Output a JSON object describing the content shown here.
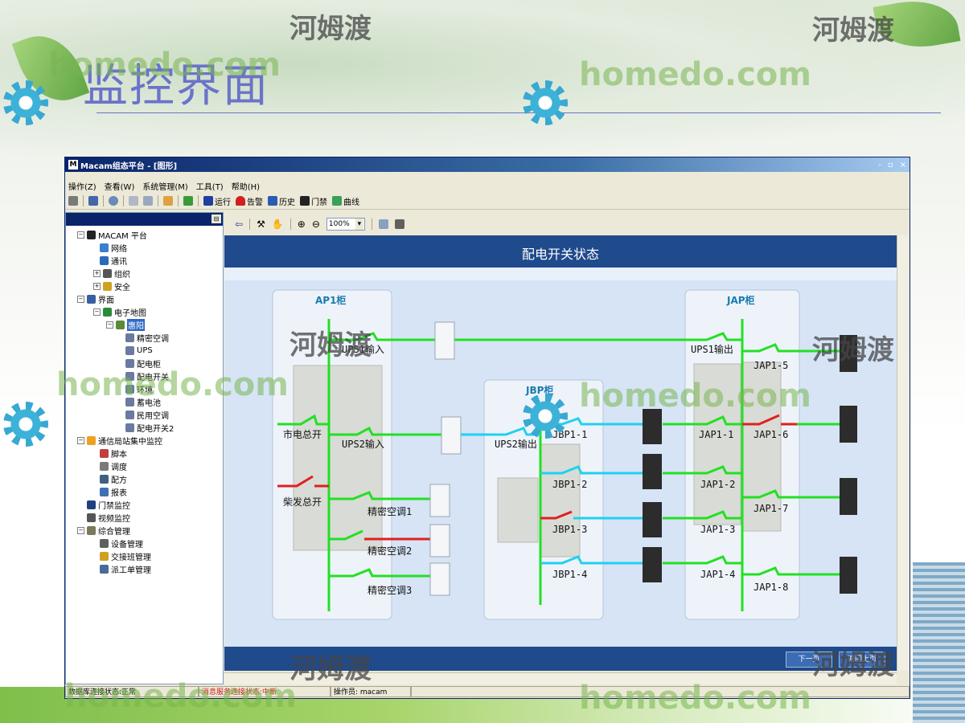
{
  "slide": {
    "title": "监控界面",
    "watermark_text_en": "homedo.com",
    "watermark_text_cn": "河姆渡"
  },
  "window": {
    "title": "Macam组态平台 - [图形]",
    "controls": [
      "-",
      "▫",
      "×"
    ]
  },
  "menu": [
    "操作(Z)",
    "查看(W)",
    "系统管理(M)",
    "工具(T)",
    "帮助(H)"
  ],
  "toolbar": {
    "buttons": [
      "运行",
      "告警",
      "历史",
      "门禁",
      "曲线"
    ]
  },
  "graphics_toolbar": {
    "zoom": "100%"
  },
  "tree": {
    "items": [
      {
        "label": "MACAM 平台",
        "icon": "macam-icon"
      },
      {
        "label": "网络",
        "icon": "network-icon"
      },
      {
        "label": "通讯",
        "icon": "globe-icon"
      },
      {
        "label": "组织",
        "icon": "org-icon"
      },
      {
        "label": "安全",
        "icon": "lock-icon"
      },
      {
        "label": "界面",
        "icon": "monitor-icon"
      },
      {
        "label": "电子地图",
        "icon": "globe-icon"
      },
      {
        "label": "惠阳",
        "icon": "node-icon"
      },
      {
        "label": "精密空调",
        "icon": "device-icon"
      },
      {
        "label": "UPS",
        "icon": "device-icon"
      },
      {
        "label": "配电柜",
        "icon": "device-icon"
      },
      {
        "label": "配电开关",
        "icon": "device-icon"
      },
      {
        "label": "环境",
        "icon": "device-icon"
      },
      {
        "label": "蓄电池",
        "icon": "device-icon"
      },
      {
        "label": "民用空调",
        "icon": "device-icon"
      },
      {
        "label": "配电开关2",
        "icon": "device-icon"
      },
      {
        "label": "通信局站集中监控",
        "icon": "sun-icon"
      },
      {
        "label": "脚本",
        "icon": "script-icon"
      },
      {
        "label": "调度",
        "icon": "schedule-icon"
      },
      {
        "label": "配方",
        "icon": "recipe-icon"
      },
      {
        "label": "报表",
        "icon": "report-icon"
      },
      {
        "label": "门禁监控",
        "icon": "door-icon"
      },
      {
        "label": "视频监控",
        "icon": "video-icon"
      },
      {
        "label": "综合管理",
        "icon": "manage-icon"
      },
      {
        "label": "设备管理",
        "icon": "device-mgmt-icon"
      },
      {
        "label": "交接班管理",
        "icon": "shift-icon"
      },
      {
        "label": "派工单管理",
        "icon": "workorder-icon"
      }
    ]
  },
  "diagram": {
    "title": "配电开关状态",
    "cabinets": {
      "ap1": "AP1柜",
      "jbp": "JBP柜",
      "jap": "JAP柜"
    },
    "labels": {
      "ups1_in": "UPS1输入",
      "ups2_in": "UPS2输入",
      "mains": "市电总开",
      "diesel": "柴发总开",
      "ac1": "精密空调1",
      "ac2": "精密空调2",
      "ac3": "精密空调3",
      "ups2_out": "UPS2输出",
      "ups1_out": "UPS1输出",
      "jbp1_1": "JBP1-1",
      "jbp1_2": "JBP1-2",
      "jbp1_3": "JBP1-3",
      "jbp1_4": "JBP1-4",
      "jap1_1": "JAP1-1",
      "jap1_2": "JAP1-2",
      "jap1_3": "JAP1-3",
      "jap1_4": "JAP1-4",
      "jap1_5": "JAP1-5",
      "jap1_6": "JAP1-6",
      "jap1_7": "JAP1-7",
      "jap1_8": "JAP1-8"
    },
    "colors": {
      "on": "#22e022",
      "off": "#e02020",
      "ups_line": "#20d0f0"
    },
    "nav": {
      "next": "下一页",
      "back": "返回上页"
    }
  },
  "status": {
    "db": "数据库连接状态:正常",
    "msg": "消息服务连接状态:中断",
    "operator": "操作员: macam"
  }
}
